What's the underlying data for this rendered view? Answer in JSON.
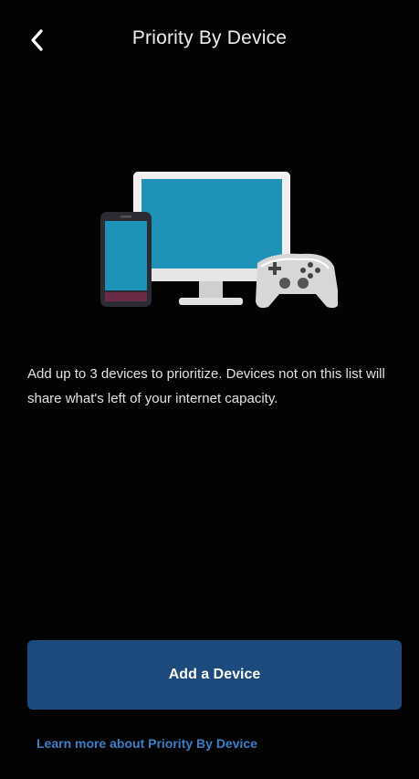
{
  "header": {
    "title": "Priority By Device",
    "back_icon": "chevron-left-icon"
  },
  "illustration": {
    "icon": "devices-illustration",
    "screen_color": "#1e92b8",
    "frame_color": "#f0f0f0"
  },
  "body": {
    "description": "Add up to 3 devices to prioritize. Devices not on this list will share what's left of your internet capacity."
  },
  "actions": {
    "add_device_label": "Add a Device",
    "learn_more_label": "Learn more about Priority By Device"
  },
  "colors": {
    "background": "#030303",
    "primary_button": "#1d4a7c",
    "link": "#3b7fc7"
  }
}
